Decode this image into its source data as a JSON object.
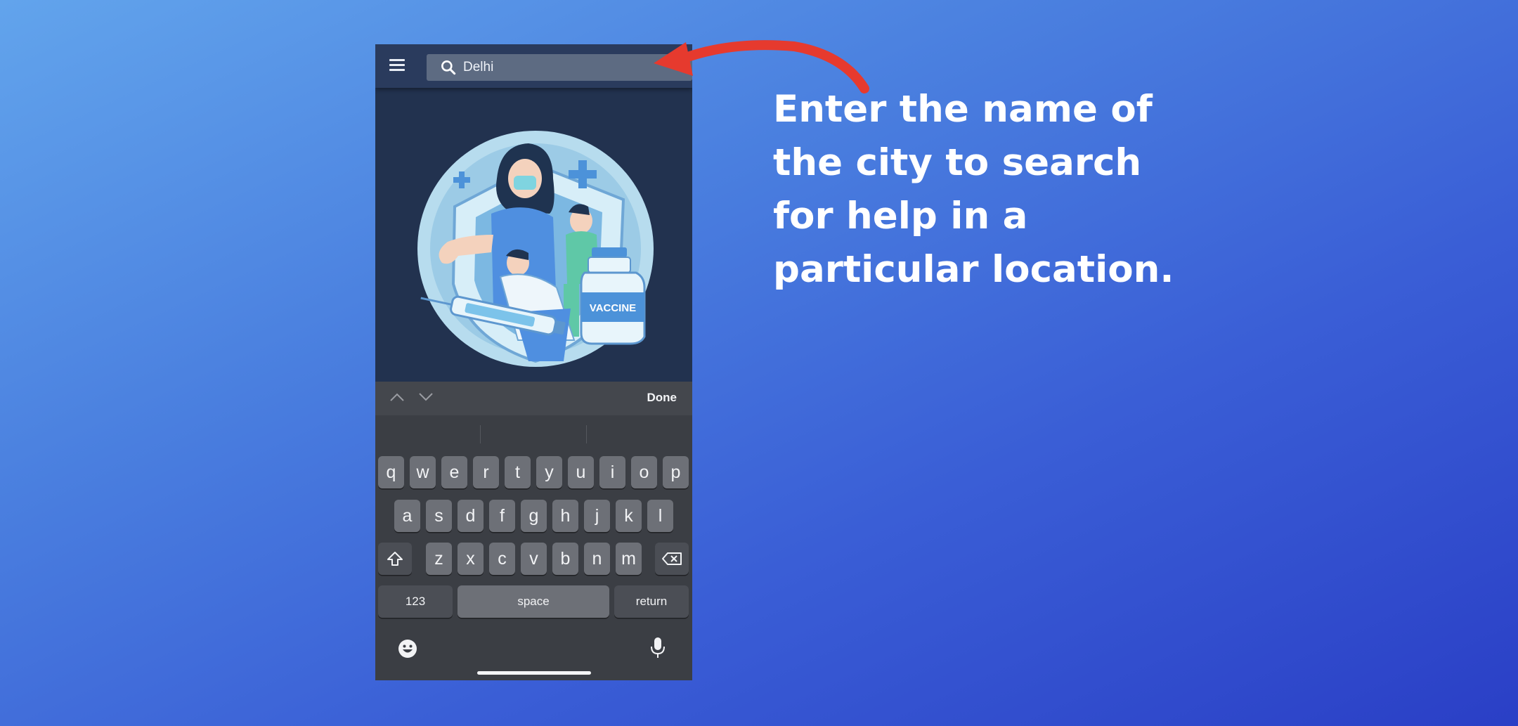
{
  "search": {
    "value": "Delhi"
  },
  "hero": {
    "badge_text": "VACCINE"
  },
  "keyboard": {
    "done_label": "Done",
    "row1": [
      "q",
      "w",
      "e",
      "r",
      "t",
      "y",
      "u",
      "i",
      "o",
      "p"
    ],
    "row2": [
      "a",
      "s",
      "d",
      "f",
      "g",
      "h",
      "j",
      "k",
      "l"
    ],
    "row3": [
      "z",
      "x",
      "c",
      "v",
      "b",
      "n",
      "m"
    ],
    "numbers_label": "123",
    "space_label": "space",
    "return_label": "return"
  },
  "caption": {
    "line1": "Enter the name of",
    "line2": "the city to search",
    "line3": "for help in a",
    "line4": "particular location."
  },
  "colors": {
    "annotation_arrow": "#e63a2e",
    "app_bg": "#22324f",
    "keyboard_bg": "#3b3e44"
  }
}
